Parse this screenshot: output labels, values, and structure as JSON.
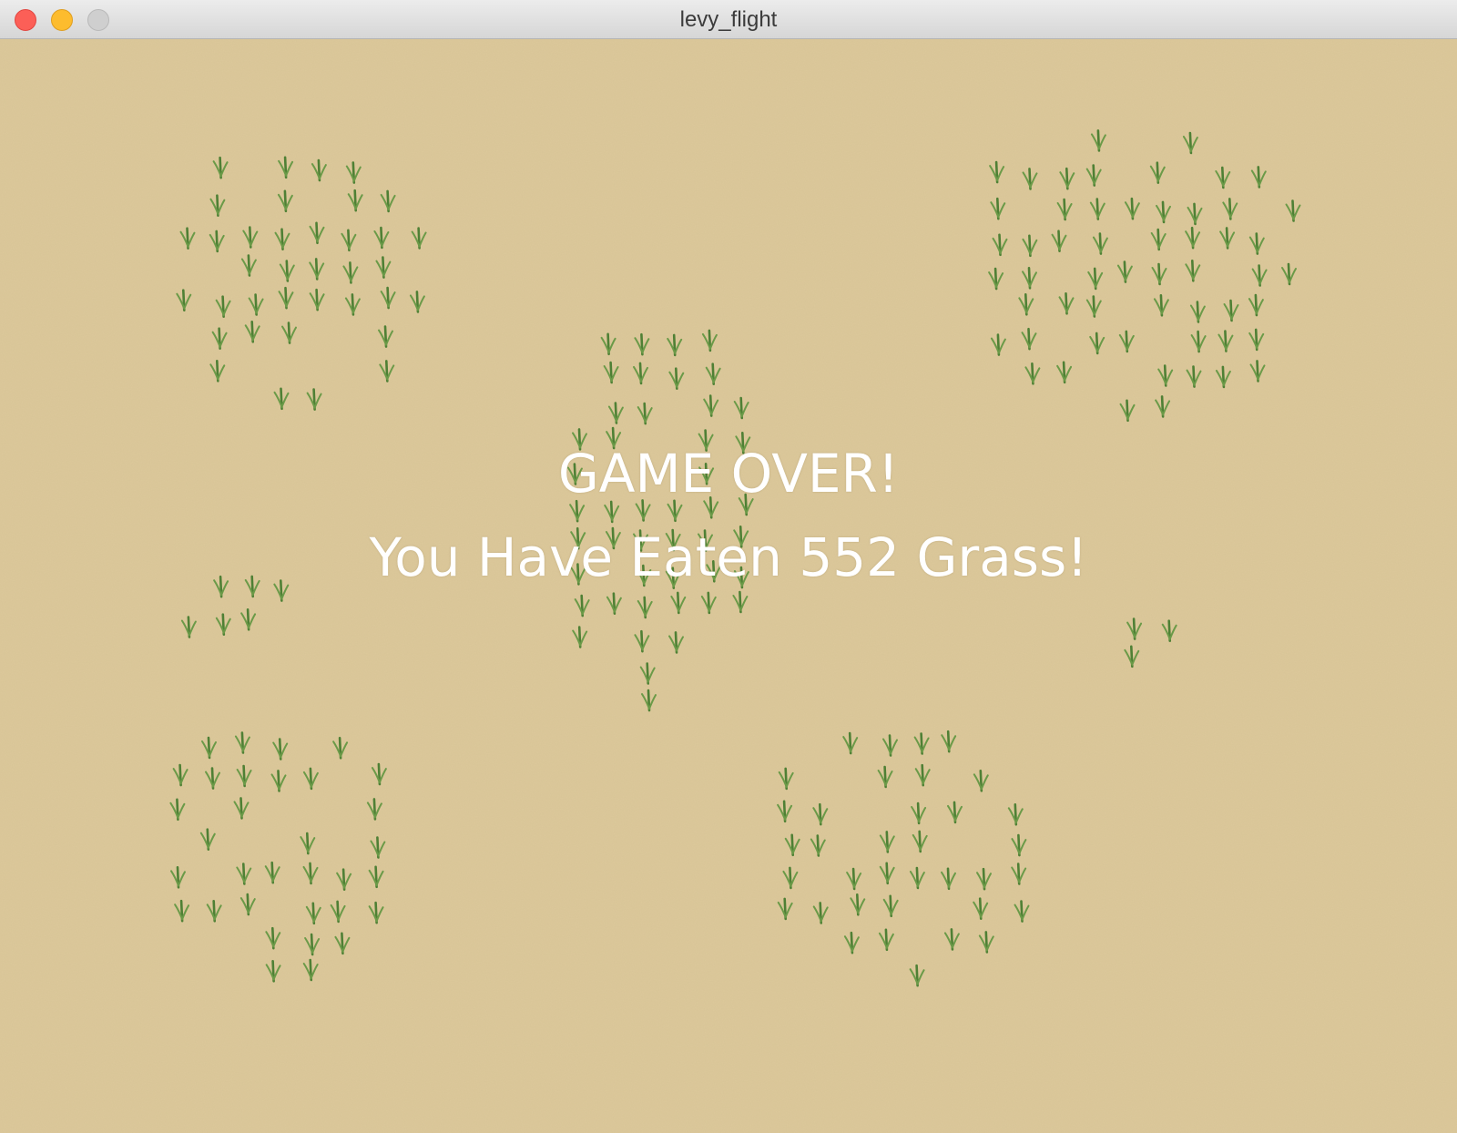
{
  "window": {
    "title": "levy_flight",
    "buttons": [
      "close",
      "minimize",
      "zoom"
    ]
  },
  "game": {
    "over_text": "GAME OVER!",
    "score_text": "You Have Eaten 552 Grass!",
    "grass_eaten": 552
  },
  "colors": {
    "sand": "#ddc99b",
    "grass": "#5a8a3a",
    "text": "#ffffff"
  },
  "icons": {
    "close": "close-icon",
    "minimize": "minimize-icon",
    "zoom": "zoom-icon",
    "grass": "grass-tuft-icon"
  }
}
